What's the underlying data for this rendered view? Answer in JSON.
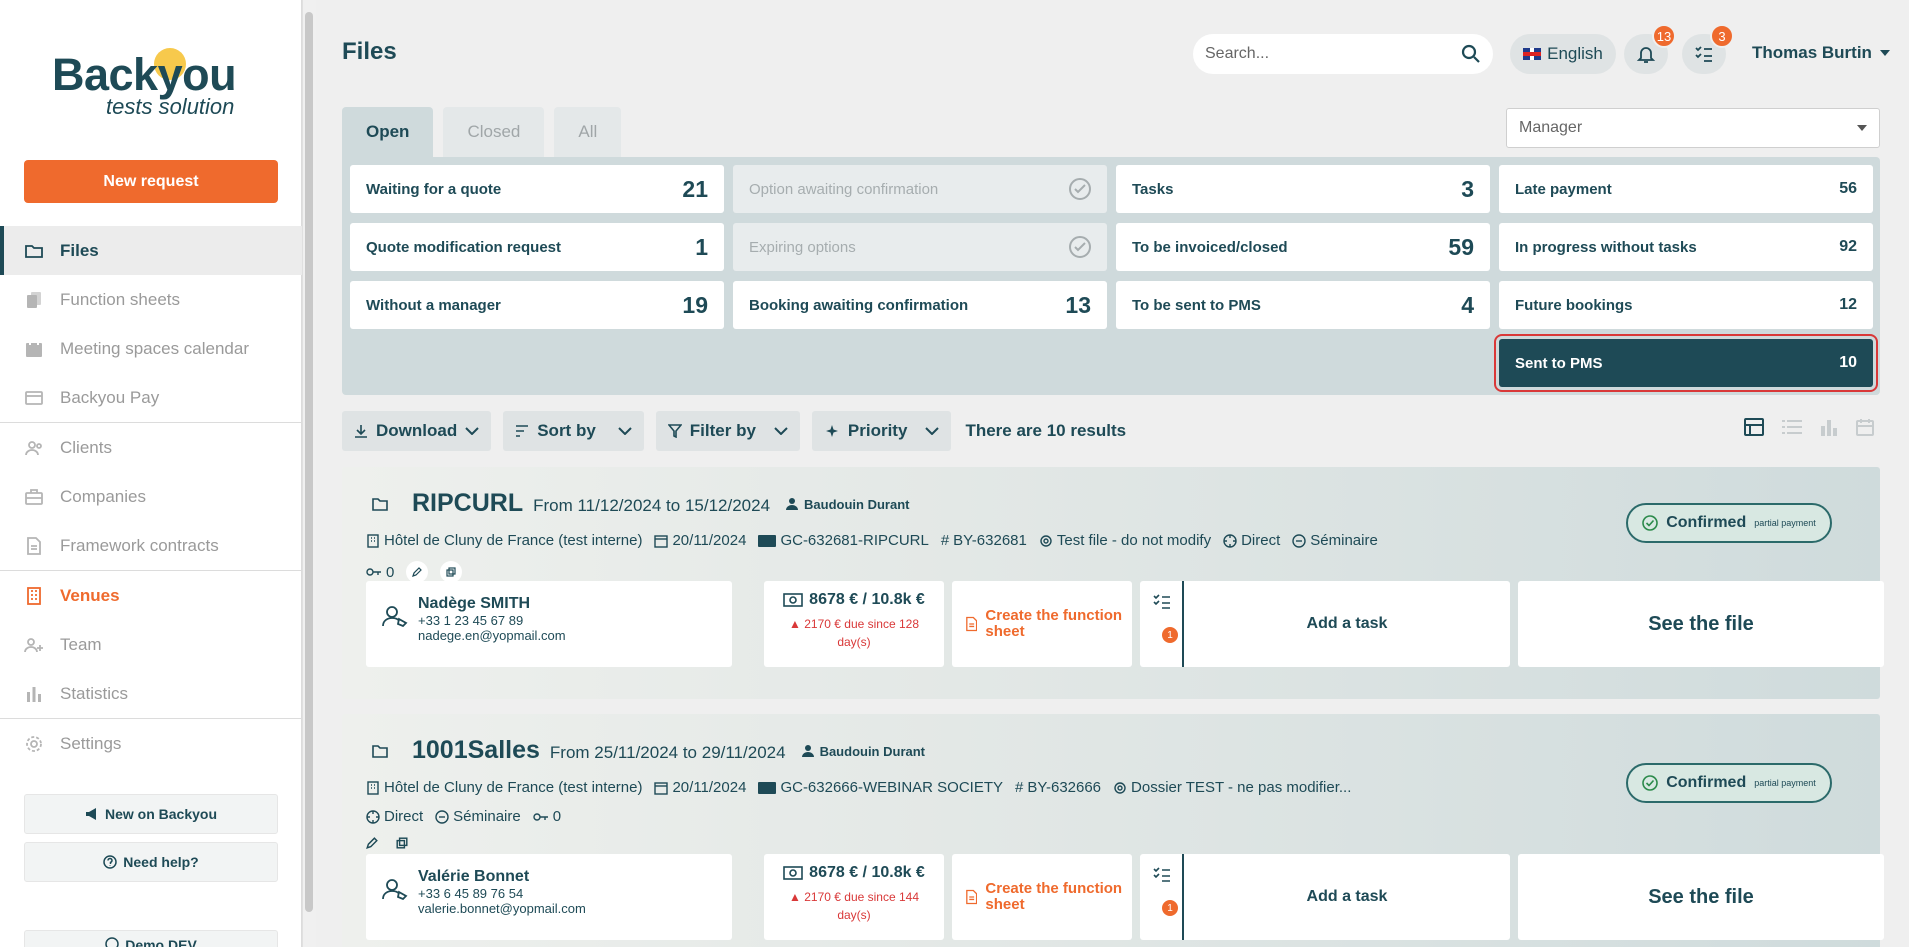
{
  "sidebar": {
    "logo_main": "Backyou",
    "logo_sub": "tests solution",
    "new_request": "New request",
    "items": [
      {
        "label": "Files"
      },
      {
        "label": "Function sheets"
      },
      {
        "label": "Meeting spaces calendar"
      },
      {
        "label": "Backyou Pay"
      },
      {
        "label": "Clients"
      },
      {
        "label": "Companies"
      },
      {
        "label": "Framework contracts"
      },
      {
        "label": "Venues"
      },
      {
        "label": "Team"
      },
      {
        "label": "Statistics"
      },
      {
        "label": "Settings"
      }
    ],
    "new_on": "New on Backyou",
    "need_help": "Need help?",
    "bottom_partial": "Demo DEV"
  },
  "header": {
    "title": "Files",
    "search_placeholder": "Search...",
    "language": "English",
    "notifications_count": "13",
    "tasks_count": "3",
    "user_name": "Thomas Burtin"
  },
  "tabs": [
    {
      "label": "Open"
    },
    {
      "label": "Closed"
    },
    {
      "label": "All"
    }
  ],
  "manager_select": "Manager",
  "cards": [
    {
      "label": "Waiting for a quote",
      "count": "21"
    },
    {
      "label": "Quote modification request",
      "count": "1"
    },
    {
      "label": "Without a manager",
      "count": "19"
    },
    {
      "label": "Option awaiting confirmation"
    },
    {
      "label": "Expiring options"
    },
    {
      "label": "Booking awaiting confirmation",
      "count": "13"
    },
    {
      "label": "Tasks",
      "count": "3"
    },
    {
      "label": "To be invoiced/closed",
      "count": "59"
    },
    {
      "label": "To be sent to PMS",
      "count": "4"
    },
    {
      "label": "Late payment",
      "count": "56"
    },
    {
      "label": "In progress without tasks",
      "count": "92"
    },
    {
      "label": "Future bookings",
      "count": "12"
    },
    {
      "label": "Sent to PMS",
      "count": "10"
    }
  ],
  "toolbar": {
    "download": "Download",
    "sort": "Sort by",
    "filter": "Filter by",
    "priority": "Priority",
    "results": "There are 10 results"
  },
  "files": [
    {
      "name": "RIPCURL",
      "dates": "From 11/12/2024 to 15/12/2024",
      "manager": "Baudouin Durant",
      "hotel": "Hôtel de Cluny de France (test interne)",
      "date": "20/11/2024",
      "gc": "GC-632681-RIPCURL",
      "by": "BY-632681",
      "test": "Test file - do not modify",
      "channel": "Direct",
      "type": "Séminaire",
      "keys": "0",
      "status": "Confirmed",
      "status_sub": "partial payment",
      "contact_name": "Nadège SMITH",
      "contact_phone": "+33 1 23 45 67 89",
      "contact_email": "nadege.en@yopmail.com",
      "amount": "8678 € / 10.8k €",
      "due": "2170 € due since 128 day(s)",
      "function_sheet": "Create the function sheet",
      "task_badge": "1",
      "add_task": "Add a task",
      "see_file": "See the file"
    },
    {
      "name": "1001Salles",
      "dates": "From 25/11/2024 to 29/11/2024",
      "manager": "Baudouin Durant",
      "hotel": "Hôtel de Cluny de France (test interne)",
      "date": "20/11/2024",
      "gc": "GC-632666-WEBINAR SOCIETY",
      "by": "BY-632666",
      "test": "Dossier TEST - ne pas modifier...",
      "channel": "Direct",
      "type": "Séminaire",
      "keys": "0",
      "status": "Confirmed",
      "status_sub": "partial payment",
      "contact_name": "Valérie Bonnet",
      "contact_phone": "+33 6 45 89 76 54",
      "contact_email": "valerie.bonnet@yopmail.com",
      "amount": "8678 € / 10.8k €",
      "due": "2170 € due since 144 day(s)",
      "function_sheet": "Create the function sheet",
      "task_badge": "1",
      "add_task": "Add a task",
      "see_file": "See the file"
    }
  ],
  "colors": {
    "primary": "#1e4a56",
    "accent": "#ef6a2d",
    "alert": "#d93838",
    "sun": "#f6c02d"
  }
}
